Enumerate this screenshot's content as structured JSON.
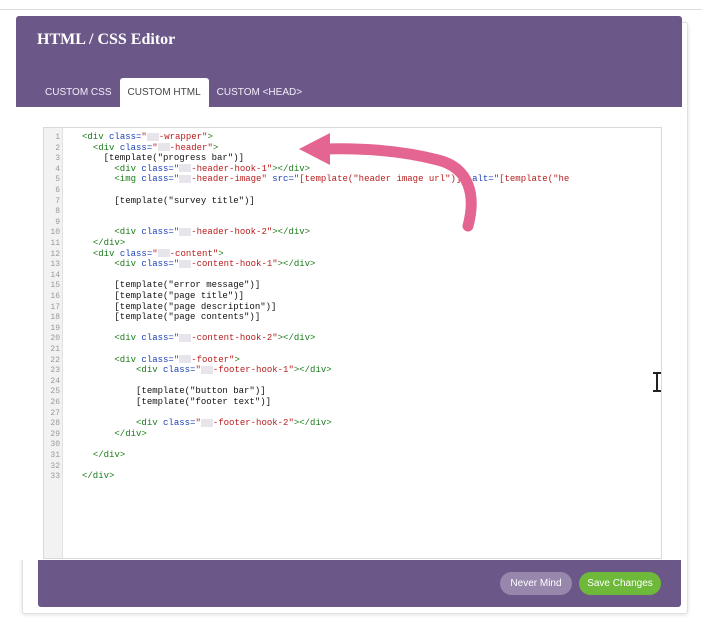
{
  "dialog": {
    "title": "HTML / CSS Editor",
    "tabs": [
      {
        "label": "CUSTOM CSS",
        "active": false
      },
      {
        "label": "CUSTOM HTML",
        "active": true
      },
      {
        "label": "CUSTOM <HEAD>",
        "active": false
      }
    ]
  },
  "editor": {
    "lines": [
      {
        "n": "1",
        "indent": "",
        "parts": [
          [
            "tag",
            "<div "
          ],
          [
            "attr",
            "class="
          ],
          [
            "val",
            "\""
          ],
          [
            "mask",
            ""
          ],
          [
            "val",
            "-wrapper\""
          ],
          [
            "tag",
            ">"
          ]
        ]
      },
      {
        "n": "2",
        "indent": "  ",
        "parts": [
          [
            "tag",
            "<div "
          ],
          [
            "attr",
            "class="
          ],
          [
            "val",
            "\""
          ],
          [
            "mask",
            ""
          ],
          [
            "val",
            "-header\""
          ],
          [
            "tag",
            ">"
          ]
        ]
      },
      {
        "n": "3",
        "indent": "    ",
        "parts": [
          [
            "txt",
            "[template(\"progress bar\")]"
          ]
        ]
      },
      {
        "n": "4",
        "indent": "      ",
        "parts": [
          [
            "tag",
            "<div "
          ],
          [
            "attr",
            "class="
          ],
          [
            "val",
            "\""
          ],
          [
            "mask",
            ""
          ],
          [
            "val",
            "-header-hook-1\""
          ],
          [
            "tag",
            "></div>"
          ]
        ]
      },
      {
        "n": "5",
        "indent": "      ",
        "parts": [
          [
            "tag",
            "<img "
          ],
          [
            "attr",
            "class="
          ],
          [
            "val",
            "\""
          ],
          [
            "mask",
            ""
          ],
          [
            "val",
            "-header-image\" "
          ],
          [
            "attr",
            "src="
          ],
          [
            "val",
            "\"[template(\"header image url\")]\" "
          ],
          [
            "attr",
            "alt="
          ],
          [
            "val",
            "\"[template(\"he"
          ]
        ]
      },
      {
        "n": "6",
        "indent": "",
        "parts": []
      },
      {
        "n": "7",
        "indent": "      ",
        "parts": [
          [
            "txt",
            "[template(\"survey title\")]"
          ]
        ]
      },
      {
        "n": "8",
        "indent": "",
        "parts": []
      },
      {
        "n": "9",
        "indent": "",
        "parts": []
      },
      {
        "n": "10",
        "indent": "      ",
        "parts": [
          [
            "tag",
            "<div "
          ],
          [
            "attr",
            "class="
          ],
          [
            "val",
            "\""
          ],
          [
            "mask",
            ""
          ],
          [
            "val",
            "-header-hook-2\""
          ],
          [
            "tag",
            "></div>"
          ]
        ]
      },
      {
        "n": "11",
        "indent": "  ",
        "parts": [
          [
            "tag",
            "</div>"
          ]
        ]
      },
      {
        "n": "12",
        "indent": "  ",
        "parts": [
          [
            "tag",
            "<div "
          ],
          [
            "attr",
            "class="
          ],
          [
            "val",
            "\""
          ],
          [
            "mask",
            ""
          ],
          [
            "val",
            "-content\""
          ],
          [
            "tag",
            ">"
          ]
        ]
      },
      {
        "n": "13",
        "indent": "      ",
        "parts": [
          [
            "tag",
            "<div "
          ],
          [
            "attr",
            "class="
          ],
          [
            "val",
            "\""
          ],
          [
            "mask",
            ""
          ],
          [
            "val",
            "-content-hook-1\""
          ],
          [
            "tag",
            "></div>"
          ]
        ]
      },
      {
        "n": "14",
        "indent": "",
        "parts": []
      },
      {
        "n": "15",
        "indent": "      ",
        "parts": [
          [
            "txt",
            "[template(\"error message\")]"
          ]
        ]
      },
      {
        "n": "16",
        "indent": "      ",
        "parts": [
          [
            "txt",
            "[template(\"page title\")]"
          ]
        ]
      },
      {
        "n": "17",
        "indent": "      ",
        "parts": [
          [
            "txt",
            "[template(\"page description\")]"
          ]
        ]
      },
      {
        "n": "18",
        "indent": "      ",
        "parts": [
          [
            "txt",
            "[template(\"page contents\")]"
          ]
        ]
      },
      {
        "n": "19",
        "indent": "",
        "parts": []
      },
      {
        "n": "20",
        "indent": "      ",
        "parts": [
          [
            "tag",
            "<div "
          ],
          [
            "attr",
            "class="
          ],
          [
            "val",
            "\""
          ],
          [
            "mask",
            ""
          ],
          [
            "val",
            "-content-hook-2\""
          ],
          [
            "tag",
            "></div>"
          ]
        ]
      },
      {
        "n": "21",
        "indent": "",
        "parts": []
      },
      {
        "n": "22",
        "indent": "      ",
        "parts": [
          [
            "tag",
            "<div "
          ],
          [
            "attr",
            "class="
          ],
          [
            "val",
            "\""
          ],
          [
            "mask",
            ""
          ],
          [
            "val",
            "-footer\""
          ],
          [
            "tag",
            ">"
          ]
        ]
      },
      {
        "n": "23",
        "indent": "          ",
        "parts": [
          [
            "tag",
            "<div "
          ],
          [
            "attr",
            "class="
          ],
          [
            "val",
            "\""
          ],
          [
            "mask",
            ""
          ],
          [
            "val",
            "-footer-hook-1\""
          ],
          [
            "tag",
            "></div>"
          ]
        ]
      },
      {
        "n": "24",
        "indent": "",
        "parts": []
      },
      {
        "n": "25",
        "indent": "          ",
        "parts": [
          [
            "txt",
            "[template(\"button bar\")]"
          ]
        ]
      },
      {
        "n": "26",
        "indent": "          ",
        "parts": [
          [
            "txt",
            "[template(\"footer text\")]"
          ]
        ]
      },
      {
        "n": "27",
        "indent": "",
        "parts": []
      },
      {
        "n": "28",
        "indent": "          ",
        "parts": [
          [
            "tag",
            "<div "
          ],
          [
            "attr",
            "class="
          ],
          [
            "val",
            "\""
          ],
          [
            "mask",
            ""
          ],
          [
            "val",
            "-footer-hook-2\""
          ],
          [
            "tag",
            "></div>"
          ]
        ]
      },
      {
        "n": "29",
        "indent": "      ",
        "parts": [
          [
            "tag",
            "</div>"
          ]
        ]
      },
      {
        "n": "30",
        "indent": "",
        "parts": []
      },
      {
        "n": "31",
        "indent": "  ",
        "parts": [
          [
            "tag",
            "</div>"
          ]
        ]
      },
      {
        "n": "32",
        "indent": "",
        "parts": []
      },
      {
        "n": "33",
        "indent": "",
        "parts": [
          [
            "tag",
            "</div>"
          ]
        ]
      }
    ]
  },
  "footer": {
    "never_mind_label": "Never Mind",
    "save_label": "Save Changes"
  },
  "colors": {
    "header_purple": "#6b5889",
    "save_green": "#6fb93a",
    "arrow_pink": "#e56592"
  },
  "icons": {
    "cursor": "text-cursor-icon",
    "annotation": "curved-arrow-icon"
  }
}
